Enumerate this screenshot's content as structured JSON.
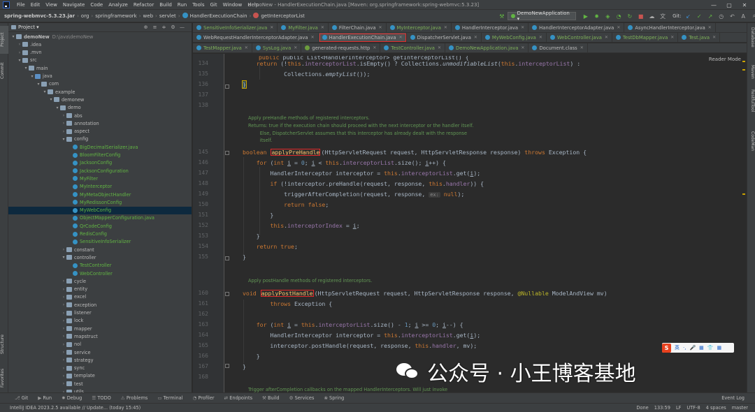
{
  "menubar": {
    "items": [
      "File",
      "Edit",
      "View",
      "Navigate",
      "Code",
      "Analyze",
      "Refactor",
      "Build",
      "Run",
      "Tools",
      "Git",
      "Window",
      "Help"
    ],
    "title": "demoNew - HandlerExecutionChain.java [Maven: org.springframework:spring-webmvc:5.3.23]"
  },
  "breadcrumbs": [
    "spring-webmvc-5.3.23.jar",
    "org",
    "springframework",
    "web",
    "servlet",
    "HandlerExecutionChain",
    "getInterceptorList"
  ],
  "toolbar": {
    "run_config": "DemoNewApplication ▾",
    "git_label": "Git:"
  },
  "project_panel": {
    "title": "Project ▾"
  },
  "tree": [
    {
      "indent": 0,
      "tw": "▾",
      "icon": "folder",
      "label": "demoNew",
      "extra": "D:\\java\\demoNew",
      "bold": true
    },
    {
      "indent": 1,
      "tw": "›",
      "icon": "folder",
      "label": ".idea"
    },
    {
      "indent": 1,
      "tw": "›",
      "icon": "folder",
      "label": ".mvn"
    },
    {
      "indent": 1,
      "tw": "▾",
      "icon": "folder",
      "label": "src"
    },
    {
      "indent": 2,
      "tw": "▾",
      "icon": "folder",
      "label": "main"
    },
    {
      "indent": 3,
      "tw": "▾",
      "icon": "folder blue",
      "label": "java"
    },
    {
      "indent": 4,
      "tw": "▾",
      "icon": "folder",
      "label": "com"
    },
    {
      "indent": 5,
      "tw": "▾",
      "icon": "folder",
      "label": "example"
    },
    {
      "indent": 6,
      "tw": "▾",
      "icon": "folder",
      "label": "demonew"
    },
    {
      "indent": 7,
      "tw": "▾",
      "icon": "folder",
      "label": "demo"
    },
    {
      "indent": 8,
      "tw": "›",
      "icon": "folder",
      "label": "abs"
    },
    {
      "indent": 8,
      "tw": "›",
      "icon": "folder",
      "label": "annotation"
    },
    {
      "indent": 8,
      "tw": "›",
      "icon": "folder",
      "label": "aspect"
    },
    {
      "indent": 8,
      "tw": "▾",
      "icon": "folder",
      "label": "config"
    },
    {
      "indent": 9,
      "tw": "",
      "icon": "class",
      "label": "BigDecimalSerializer.java",
      "green": true
    },
    {
      "indent": 9,
      "tw": "",
      "icon": "class",
      "label": "BloomFilterConfig",
      "green": true
    },
    {
      "indent": 9,
      "tw": "",
      "icon": "class",
      "label": "JacksonConfig",
      "green": true
    },
    {
      "indent": 9,
      "tw": "",
      "icon": "class",
      "label": "JacksonConfiguration",
      "green": true
    },
    {
      "indent": 9,
      "tw": "",
      "icon": "class",
      "label": "MyFilter",
      "green": true
    },
    {
      "indent": 9,
      "tw": "",
      "icon": "class",
      "label": "MyInterceptor",
      "green": true
    },
    {
      "indent": 9,
      "tw": "",
      "icon": "class",
      "label": "MyMetaObjectHandler",
      "green": true
    },
    {
      "indent": 9,
      "tw": "",
      "icon": "class",
      "label": "MyRedissonConfig",
      "green": true
    },
    {
      "indent": 9,
      "tw": "",
      "icon": "class",
      "label": "MyWebConfig",
      "green": true,
      "selected": true
    },
    {
      "indent": 9,
      "tw": "",
      "icon": "class",
      "label": "ObjectMapperConfiguration.java",
      "green": true
    },
    {
      "indent": 9,
      "tw": "",
      "icon": "class",
      "label": "QrCodeConfig",
      "green": true
    },
    {
      "indent": 9,
      "tw": "",
      "icon": "class",
      "label": "RedisConfig",
      "green": true
    },
    {
      "indent": 9,
      "tw": "",
      "icon": "class",
      "label": "SensitiveInfoSerializer",
      "green": true
    },
    {
      "indent": 8,
      "tw": "›",
      "icon": "folder",
      "label": "constant"
    },
    {
      "indent": 8,
      "tw": "▾",
      "icon": "folder",
      "label": "controller"
    },
    {
      "indent": 9,
      "tw": "",
      "icon": "class",
      "label": "TestController",
      "green": true
    },
    {
      "indent": 9,
      "tw": "",
      "icon": "class",
      "label": "WebController",
      "green": true
    },
    {
      "indent": 8,
      "tw": "›",
      "icon": "folder",
      "label": "cycle"
    },
    {
      "indent": 8,
      "tw": "›",
      "icon": "folder",
      "label": "entity"
    },
    {
      "indent": 8,
      "tw": "›",
      "icon": "folder",
      "label": "excel"
    },
    {
      "indent": 8,
      "tw": "›",
      "icon": "folder",
      "label": "exception"
    },
    {
      "indent": 8,
      "tw": "›",
      "icon": "folder",
      "label": "listener"
    },
    {
      "indent": 8,
      "tw": "›",
      "icon": "folder",
      "label": "lock"
    },
    {
      "indent": 8,
      "tw": "›",
      "icon": "folder",
      "label": "mapper"
    },
    {
      "indent": 8,
      "tw": "›",
      "icon": "folder",
      "label": "mapstruct"
    },
    {
      "indent": 8,
      "tw": "›",
      "icon": "folder",
      "label": "nol"
    },
    {
      "indent": 8,
      "tw": "›",
      "icon": "folder",
      "label": "service"
    },
    {
      "indent": 8,
      "tw": "›",
      "icon": "folder",
      "label": "strategy"
    },
    {
      "indent": 8,
      "tw": "›",
      "icon": "folder",
      "label": "sync"
    },
    {
      "indent": 8,
      "tw": "›",
      "icon": "folder",
      "label": "template"
    },
    {
      "indent": 8,
      "tw": "›",
      "icon": "folder",
      "label": "test"
    },
    {
      "indent": 8,
      "tw": "›",
      "icon": "folder",
      "label": "utils"
    }
  ],
  "tabs_row1": [
    {
      "label": "SensitiveInfoSerializer.java",
      "green": true
    },
    {
      "label": "MyFilter.java",
      "green": true
    },
    {
      "label": "FilterChain.java"
    },
    {
      "label": "MyInterceptor.java",
      "green": true
    },
    {
      "label": "HandlerInterceptor.java"
    },
    {
      "label": "HandlerInterceptorAdapter.java"
    },
    {
      "label": "AsyncHandlerInterceptor.java"
    }
  ],
  "tabs_row2": [
    {
      "label": "WebRequestHandlerInterceptorAdapter.java"
    },
    {
      "label": "HandlerExecutionChain.java",
      "active": true,
      "highlight": true
    },
    {
      "label": "DispatcherServlet.java"
    },
    {
      "label": "MyWebConfig.java",
      "green": true
    },
    {
      "label": "WebController.java",
      "green": true
    },
    {
      "label": "TestDbMapper.java",
      "green": true
    },
    {
      "label": "Test.java",
      "green": true
    }
  ],
  "tabs_row3": [
    {
      "label": "TestMapper.java",
      "green": true
    },
    {
      "label": "SysLog.java",
      "green": true
    },
    {
      "label": "generated-requests.http"
    },
    {
      "label": "TestController.java",
      "green": true
    },
    {
      "label": "DemoNewApplication.java",
      "green": true
    },
    {
      "label": "Document.class"
    }
  ],
  "editor": {
    "reader_mode": "Reader Mode"
  },
  "line_numbers": [
    "134",
    "135",
    "136",
    "137",
    "138",
    "145",
    "146",
    "147",
    "148",
    "149",
    "150",
    "151",
    "152",
    "153",
    "154",
    "155",
    "160",
    "161",
    "162",
    "163",
    "164",
    "165",
    "166",
    "167",
    "168"
  ],
  "doc_comments": {
    "pre": [
      "Apply preHandle methods of registered interceptors.",
      "Returns: true if the execution chain should proceed with the next interceptor or the handler itself.",
      "        Else, DispatcherServlet assumes that this interceptor has already dealt with the response",
      "        itself."
    ],
    "post": [
      "Apply postHandle methods of registered interceptors."
    ],
    "after": [
      "Trigger afterCompletion callbacks on the mapped HandlerInterceptors. Will just invoke"
    ]
  },
  "code": {
    "l133": "public List<HandlerInterceptor> getInterceptorList() {",
    "apply_pre": "applyPreHandle",
    "apply_post": "applyPostHandle"
  },
  "bottom_tools": [
    "Git",
    "Run",
    "Debug",
    "TODO",
    "Problems",
    "Terminal",
    "Profiler",
    "Endpoints",
    "Build",
    "Services",
    "Spring"
  ],
  "bottom_right": "Event Log",
  "status": {
    "left": "IntelliJ IDEA 2023.2.5 available // Update... (today 15:45)",
    "done": "Done",
    "pos": "133:59",
    "sep": "LF",
    "enc": "UTF-8",
    "indent": "4 spaces",
    "branch": "master"
  },
  "left_strip": [
    "Project",
    "Commit",
    "Structure",
    "Favorites"
  ],
  "right_strip": [
    "Database",
    "Maven",
    "RestfulTool",
    "CodeMan"
  ],
  "watermark": "公众号 · 小王博客基地",
  "ime": {
    "logo": "S",
    "items": [
      "英",
      "·,",
      "🎤",
      "▦",
      "👕",
      "▦"
    ]
  }
}
